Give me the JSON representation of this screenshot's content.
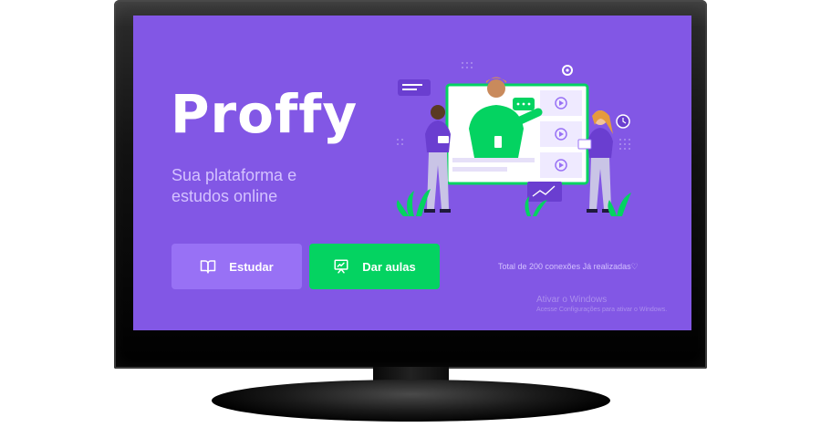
{
  "app": {
    "logo": "Proffy",
    "tagline": "Sua plataforma e estudos online"
  },
  "actions": {
    "study_label": "Estudar",
    "give_classes_label": "Dar aulas"
  },
  "connections_text": "Total de 200 conexões Já realizadas♡",
  "windows_activation": {
    "title": "Ativar o Windows",
    "subtitle": "Acesse Configurações para ativar o Windows."
  },
  "icons": {
    "study": "book-open-icon",
    "give_classes": "presentation-board-icon",
    "connections": "heart-icon"
  },
  "colors": {
    "primary": "#8257e5",
    "primary_lighter": "#9871f5",
    "secondary": "#04d361",
    "text_light": "#d4c2ff",
    "white": "#ffffff"
  }
}
